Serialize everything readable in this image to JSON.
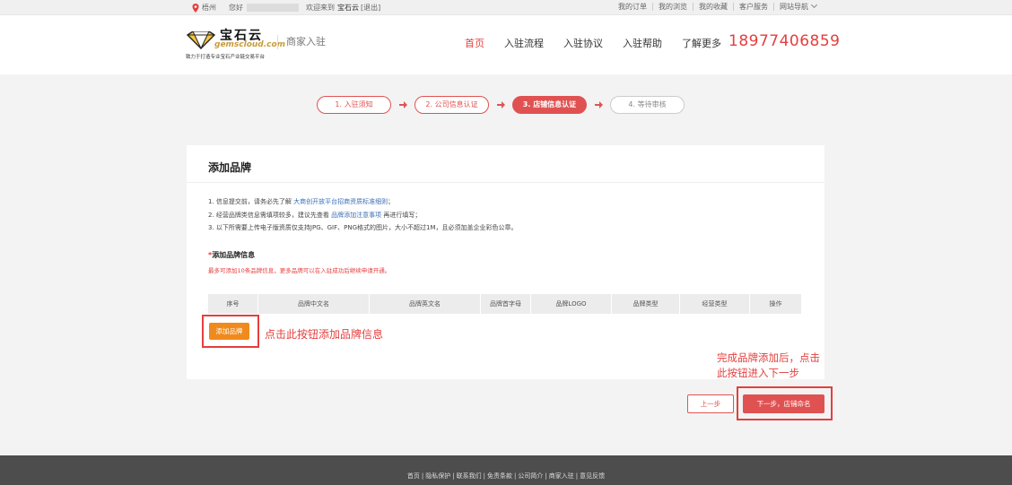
{
  "topbar": {
    "city": "梧州",
    "hello": "您好",
    "welcome": "欢迎来到",
    "site": "宝石云",
    "logout": "[退出]",
    "links": [
      "我的订单",
      "我的浏览",
      "我的收藏",
      "客户服务",
      "网站导航"
    ]
  },
  "header": {
    "logo_cn": "宝石云",
    "logo_en": "gemscloud.com",
    "slogan": "致力于打造专业宝石产业链交易平台",
    "merchant": "商家入驻",
    "nav": [
      "首页",
      "入驻流程",
      "入驻协议",
      "入驻帮助",
      "了解更多"
    ],
    "phone": "18977406859"
  },
  "steps": [
    "1. 入驻须知",
    "2. 公司信息认证",
    "3. 店铺信息认证",
    "4. 等待审核"
  ],
  "card": {
    "title": "添加品牌",
    "notes": {
      "n1_pre": "1. 信息提交前，请务必先了解",
      "n1_link": "大商创开放平台招商资质标准细则",
      "n1_post": "；",
      "n2_pre": "2. 经营品牌类信息需填项较多，建议先查看",
      "n2_link": "品牌添加注意事项",
      "n2_post": "再进行填写；",
      "n3": "3. 以下所需要上传电子版资质仅支持JPG、GIF、PNG格式的图片，大小不超过1M，且必须加盖企业彩色公章。"
    },
    "section_req": "*",
    "section_label": "添加品牌信息",
    "section_hint": "最多可添加10条品牌信息，更多品牌可以在入驻成功后继续申请开通。",
    "columns": [
      "序号",
      "品牌中文名",
      "品牌英文名",
      "品牌首字母",
      "品牌LOGO",
      "品牌类型",
      "经营类型",
      "操作"
    ],
    "add_button": "添加品牌"
  },
  "annotations": {
    "add": "点击此按钮添加品牌信息",
    "next_line1": "完成品牌添加后，点击",
    "next_line2": "此按钮进入下一步"
  },
  "buttons": {
    "prev": "上一步",
    "next": "下一步，店铺命名"
  },
  "footer": [
    "首页",
    "隐私保护",
    "联系我们",
    "免责条款",
    "公司简介",
    "商家入驻",
    "意见反馈"
  ],
  "colors": {
    "accent": "#e05252",
    "orange": "#f08a1c",
    "gold": "#c79b3a"
  }
}
